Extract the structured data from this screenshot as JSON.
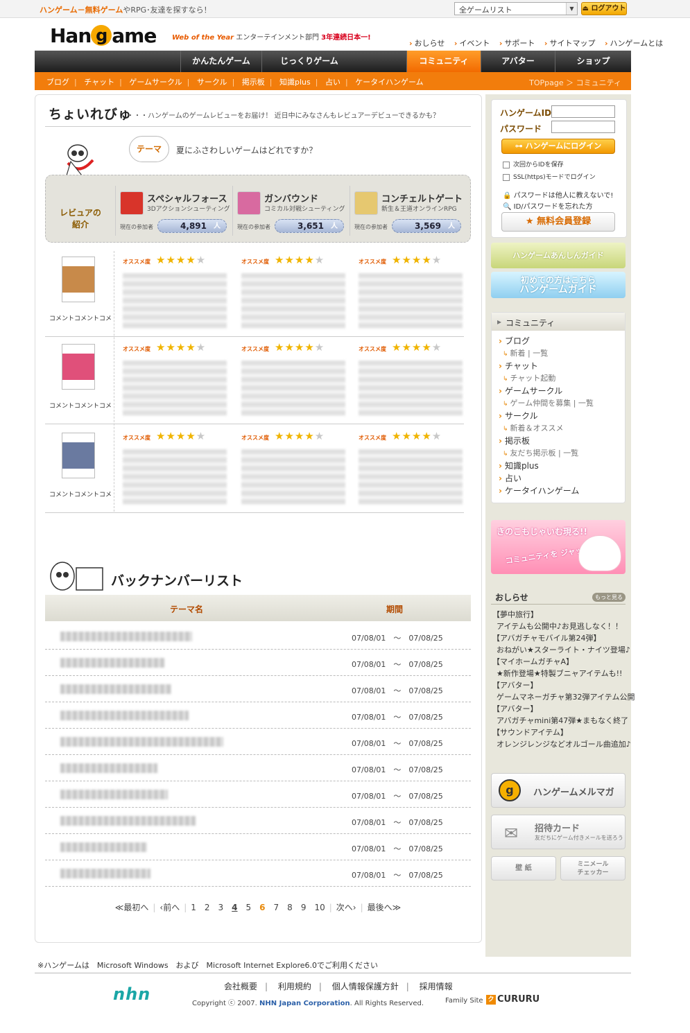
{
  "topbar": {
    "tagline_highlight": "ハンゲーム－無料ゲーム",
    "tagline_rest": "やRPG･友達を探すなら！",
    "game_select": "全ゲームリスト",
    "logout_label": "ログアウト"
  },
  "header": {
    "logo_left": "Han",
    "logo_mid": "g",
    "logo_right": "ame",
    "award_woy": "Web of the Year",
    "award_mid": " エンターテインメント部門 ",
    "award_red": "3年連続日本一!",
    "links": [
      "おしらせ",
      "イベント",
      "サポート",
      "サイトマップ",
      "ハンゲームとは"
    ]
  },
  "gnav": {
    "tabs": [
      {
        "label": "かんたんゲーム"
      },
      {
        "label": "じっくりゲーム"
      },
      {
        "label": "コミュニティ"
      },
      {
        "label": "アバター"
      },
      {
        "label": "ショップ"
      }
    ]
  },
  "subnav": {
    "items": [
      "ブログ",
      "チャット",
      "ゲームサークル",
      "サークル",
      "掲示板",
      "知識plus",
      "占い",
      "ケータイハンゲーム"
    ],
    "breadcrumb_1": "TOPpage",
    "breadcrumb_sep": " ＞ ",
    "breadcrumb_2": "コミュニティ"
  },
  "review": {
    "title": "ちょいれびゅ",
    "description": "・・・ハンゲームのゲームレビューをお届け！ 近日中にみなさんもレビュアーデビューできるかも？",
    "theme_label": "テーマ",
    "theme_text": "夏にふさわしいゲームはどれですか？",
    "intro_label_1": "レビュアの",
    "intro_label_2": "紹介",
    "participants_label": "現在の参加者",
    "unit": "人",
    "games": [
      {
        "name": "スペシャルフォース",
        "genre": "3Dアクションシューティング",
        "count": "4,891",
        "color": "#d8342a"
      },
      {
        "name": "ガンバウンド",
        "genre": "コミカル対戦シューティング",
        "count": "3,651",
        "color": "#d86aa0"
      },
      {
        "name": "コンチェルトゲート",
        "genre": "新生＆王道オンラインRPG",
        "count": "3,569",
        "color": "#e6c870"
      }
    ],
    "rating_label": "オススメ度",
    "rows": [
      {
        "caption": "コメントコメントコメ",
        "stars": 4,
        "avatar_color": "#c88a4a"
      },
      {
        "caption": "コメントコメントコメ",
        "stars": 4,
        "avatar_color": "#e0507a"
      },
      {
        "caption": "コメントコメントコメ",
        "stars": 4,
        "avatar_color": "#6a7aa0"
      }
    ]
  },
  "backnumber": {
    "title": "バックナンバーリスト",
    "col_theme": "テーマ名",
    "col_period": "期間",
    "rows": [
      {
        "period": "07/08/01　～　07/08/25"
      },
      {
        "period": "07/08/01　～　07/08/25"
      },
      {
        "period": "07/08/01　～　07/08/25"
      },
      {
        "period": "07/08/01　～　07/08/25"
      },
      {
        "period": "07/08/01　～　07/08/25"
      },
      {
        "period": "07/08/01　～　07/08/25"
      },
      {
        "period": "07/08/01　～　07/08/25"
      },
      {
        "period": "07/08/01　～　07/08/25"
      },
      {
        "period": "07/08/01　～　07/08/25"
      },
      {
        "period": "07/08/01　～　07/08/25"
      }
    ]
  },
  "pager": {
    "first": "≪最初へ",
    "prev": "‹前へ",
    "pages": [
      "1",
      "2",
      "3",
      "4",
      "5",
      "6",
      "7",
      "8",
      "9",
      "10"
    ],
    "current": "6",
    "underlined": "4",
    "next": "次へ›",
    "last": "最後へ≫"
  },
  "login": {
    "id_label": "ハンゲームID",
    "pw_label": "パスワード",
    "login_button": "ハンゲームにログイン",
    "save_id": "次回からIDを保存",
    "ssl": "SSL(https)モードでログイン",
    "note1": "パスワードは他人に教えないで!",
    "note2": "ID/パスワードを忘れた方",
    "register_button": "無料会員登録"
  },
  "banners": {
    "anshin": "ハンゲームあんしんガイド",
    "guide_1": "初めての方はこちら",
    "guide_2": "ハンゲームガイド",
    "kinoko_1": "きのこもじゃいむ現る!!",
    "kinoko_2": "コミュニティを ジャックする!?"
  },
  "community": {
    "header": "コミュニティ",
    "items": [
      {
        "type": "item",
        "label": "ブログ"
      },
      {
        "type": "sub",
        "label": "新着 | 一覧"
      },
      {
        "type": "item",
        "label": "チャット"
      },
      {
        "type": "sub",
        "label": "チャット起動"
      },
      {
        "type": "item",
        "label": "ゲームサークル"
      },
      {
        "type": "sub",
        "label": "ゲーム仲間を募集 | 一覧"
      },
      {
        "type": "item",
        "label": "サークル"
      },
      {
        "type": "sub",
        "label": "新着＆オススメ"
      },
      {
        "type": "item",
        "label": "掲示板"
      },
      {
        "type": "sub",
        "label": "友だち掲示板 | 一覧"
      },
      {
        "type": "item",
        "label": "知識plus"
      },
      {
        "type": "item",
        "label": "占い"
      },
      {
        "type": "item",
        "label": "ケータイハンゲーム"
      }
    ]
  },
  "news": {
    "header": "おしらせ",
    "more": "もっと見る",
    "items": [
      {
        "title": "【夢中旅行】",
        "body": "アイテムも公開中♪お見逃しなく！！"
      },
      {
        "title": "【アバガチャモバイル第24弾】",
        "body": "おねがい★スターライト・ナイツ登場♪"
      },
      {
        "title": "【マイホームガチャA】",
        "body": "★新作登場★特製ブニャアイテムも!!"
      },
      {
        "title": "【アバター】",
        "body": "ゲームマネーガチャ第32弾アイテム公開"
      },
      {
        "title": "【アバター】",
        "body": "アバガチャmini第47弾★まもなく終了"
      },
      {
        "title": "【サウンドアイテム】",
        "body": "オレンジレンジなどオルゴール曲追加♪"
      }
    ]
  },
  "side_buttons": {
    "mailmag": "ハンゲームメルマガ",
    "invite": "招待カード",
    "invite_sub": "友だちにゲーム付きメールを送ろう",
    "wall": "壁 紙",
    "mini_1": "ミニメール",
    "mini_2": "チェッカー"
  },
  "footer": {
    "notice": "※ハンゲームは　Microsoft Windows　および　Microsoft Internet Explore6.0でご利用ください",
    "logo": "nhn",
    "links": [
      "会社概要",
      "利用規約",
      "個人情報保護方針",
      "採用情報"
    ],
    "copyright_pre": "Copyright ⓒ 2007. ",
    "copyright_co": "NHN Japan Corporation",
    "copyright_post": ". All Rights Reserved.",
    "family": "Family Site",
    "cururu": "CURURU"
  }
}
